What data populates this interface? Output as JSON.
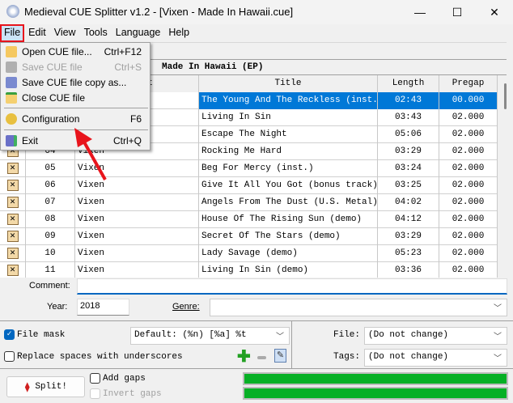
{
  "window": {
    "title": "Medieval CUE Splitter v1.2 - [Vixen - Made In Hawaii.cue]",
    "minimize": "—",
    "maximize": "☐",
    "close": "✕"
  },
  "menubar": [
    "File",
    "Edit",
    "View",
    "Tools",
    "Language",
    "Help"
  ],
  "album": "Made In Hawaii (EP)",
  "table": {
    "headers": [
      "",
      "",
      "Artist",
      "Title",
      "Length",
      "Pregap"
    ],
    "rows": [
      {
        "num": "",
        "artist": "",
        "title": "The Young And The Reckless (inst.)",
        "length": "02:43",
        "pregap": "00.000"
      },
      {
        "num": "",
        "artist": "",
        "title": "Living In Sin",
        "length": "03:43",
        "pregap": "02.000"
      },
      {
        "num": "",
        "artist": "",
        "title": "Escape The Night",
        "length": "05:06",
        "pregap": "02.000"
      },
      {
        "num": "04",
        "artist": "Vixen",
        "title": "Rocking Me Hard",
        "length": "03:29",
        "pregap": "02.000"
      },
      {
        "num": "05",
        "artist": "Vixen",
        "title": "Beg For Mercy (inst.)",
        "length": "03:24",
        "pregap": "02.000"
      },
      {
        "num": "06",
        "artist": "Vixen",
        "title": "Give It All You Got (bonus track)",
        "length": "03:25",
        "pregap": "02.000"
      },
      {
        "num": "07",
        "artist": "Vixen",
        "title": "Angels From The Dust (U.S. Metal)",
        "length": "04:02",
        "pregap": "02.000"
      },
      {
        "num": "08",
        "artist": "Vixen",
        "title": "House Of The Rising Sun (demo)",
        "length": "04:12",
        "pregap": "02.000"
      },
      {
        "num": "09",
        "artist": "Vixen",
        "title": "Secret Of The Stars (demo)",
        "length": "03:29",
        "pregap": "02.000"
      },
      {
        "num": "10",
        "artist": "Vixen",
        "title": "Lady Savage (demo)",
        "length": "05:23",
        "pregap": "02.000"
      },
      {
        "num": "11",
        "artist": "Vixen",
        "title": "Living In Sin (demo)",
        "length": "03:36",
        "pregap": "02.000"
      }
    ]
  },
  "fields": {
    "comment_label": "Comment:",
    "comment_value": "",
    "year_label": "Year:",
    "year_value": "2018",
    "genre_label": "Genre:",
    "genre_value": ""
  },
  "options": {
    "file_mask_label": "File mask",
    "file_mask_checked": true,
    "file_mask_value": "Default: (%n) [%a] %t",
    "replace_label": "Replace spaces with underscores",
    "replace_checked": false,
    "file_label": "File:",
    "file_value": "(Do not change)",
    "tags_label": "Tags:",
    "tags_value": "(Do not change)"
  },
  "bottom": {
    "split_label": "Split!",
    "add_gaps_label": "Add gaps",
    "invert_gaps_label": "Invert gaps",
    "progress1": 100,
    "progress2": 100
  },
  "file_menu": [
    {
      "label": "Open CUE file...",
      "shortcut": "Ctrl+F12",
      "enabled": true
    },
    {
      "label": "Save CUE file",
      "shortcut": "Ctrl+S",
      "enabled": false
    },
    {
      "label": "Save CUE file copy as...",
      "shortcut": "",
      "enabled": true
    },
    {
      "label": "Close CUE file",
      "shortcut": "",
      "enabled": true
    },
    {
      "label": "Configuration",
      "shortcut": "F6",
      "enabled": true
    },
    {
      "label": "Exit",
      "shortcut": "Ctrl+Q",
      "enabled": true
    }
  ],
  "colors": {
    "selection": "#0078d7",
    "progress": "#06b025",
    "annotation": "#e8141c"
  }
}
